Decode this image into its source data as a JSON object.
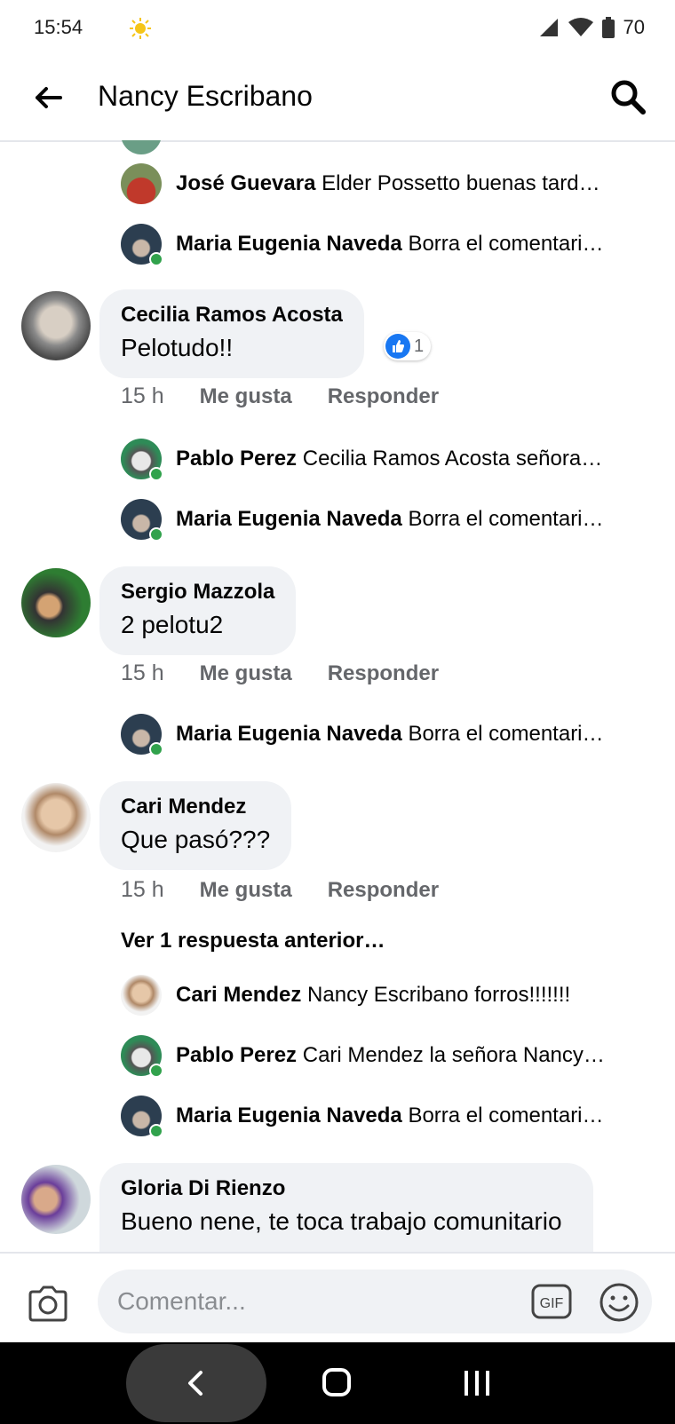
{
  "status": {
    "time": "15:54",
    "battery": "70"
  },
  "header": {
    "title": "Nancy Escribano"
  },
  "replies_top": [
    {
      "name": "José Guevara",
      "text": "Elder Possetto  buenas tard…"
    },
    {
      "name": "Maria Eugenia Naveda",
      "text": "Borra el comentari…"
    }
  ],
  "comments": [
    {
      "name": "Cecilia Ramos Acosta",
      "text": "Pelotudo!!",
      "reaction_count": "1",
      "time": "15 h",
      "like_label": "Me gusta",
      "reply_label": "Responder",
      "replies": [
        {
          "name": "Pablo Perez",
          "text": "Cecilia Ramos Acosta señora…"
        },
        {
          "name": "Maria Eugenia Naveda",
          "text": "Borra el comentari…"
        }
      ]
    },
    {
      "name": "Sergio Mazzola",
      "text": "2 pelotu2",
      "time": "15 h",
      "like_label": "Me gusta",
      "reply_label": "Responder",
      "replies": [
        {
          "name": "Maria Eugenia Naveda",
          "text": "Borra el comentari…"
        }
      ]
    },
    {
      "name": "Cari Mendez",
      "text": "Que pasó???",
      "time": "15 h",
      "like_label": "Me gusta",
      "reply_label": "Responder",
      "view_more": "Ver 1 respuesta anterior…",
      "replies": [
        {
          "name": "Cari Mendez",
          "text": "Nancy Escribano forros!!!!!!!"
        },
        {
          "name": "Pablo Perez",
          "text": "Cari Mendez la señora Nancy…"
        },
        {
          "name": "Maria Eugenia Naveda",
          "text": "Borra el comentari…"
        }
      ]
    },
    {
      "name": "Gloria Di Rienzo",
      "text": "Bueno nene, te toca trabajo comunitario"
    }
  ],
  "composer": {
    "placeholder": "Comentar...",
    "gif_label": "GIF"
  },
  "colors": {
    "bubble": "#f0f2f5",
    "meta": "#65676b",
    "like_blue": "#1877f2",
    "online_green": "#31a24c"
  },
  "icons": [
    "sun-icon",
    "signal-icon",
    "wifi-icon",
    "battery-icon",
    "back-arrow-icon",
    "search-icon",
    "like-icon",
    "camera-icon",
    "gif-icon",
    "emoji-icon",
    "nav-back-icon",
    "nav-home-icon",
    "nav-recents-icon"
  ]
}
